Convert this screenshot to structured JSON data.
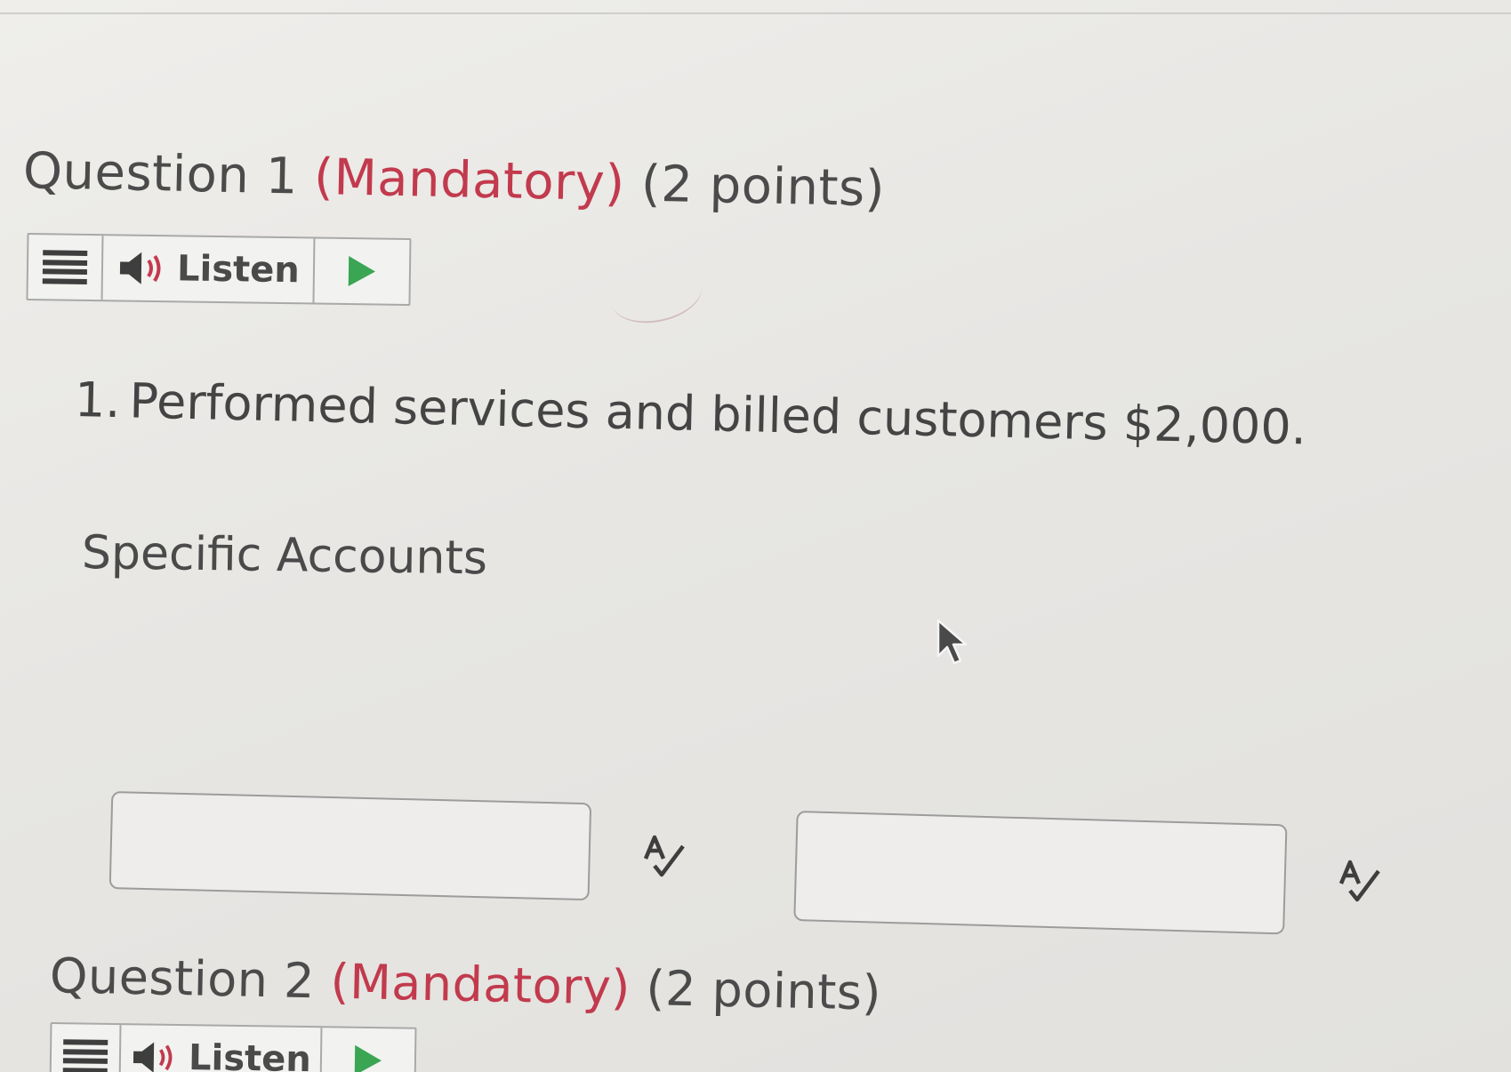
{
  "questions": [
    {
      "title_prefix": "Question 1",
      "mandatory": "(Mandatory)",
      "points": "(2 points)",
      "listen_label": "Listen",
      "item": {
        "number": "1.",
        "text": "Performed services and billed customers $2,000."
      },
      "section_label": "Specific Accounts",
      "inputs": [
        {
          "value": ""
        },
        {
          "value": ""
        }
      ]
    },
    {
      "title_prefix": "Question 2",
      "mandatory": "(Mandatory)",
      "points": "(2 points)",
      "listen_label": "Listen"
    }
  ],
  "icons": {
    "menu": "menu-icon",
    "speaker": "speaker-icon",
    "play": "play-icon",
    "spellcheck": "spellcheck-icon",
    "cursor": "mouse-pointer-icon"
  },
  "colors": {
    "mandatory": "#c23a4d",
    "play": "#3aa553",
    "text": "#4a4a4a"
  }
}
